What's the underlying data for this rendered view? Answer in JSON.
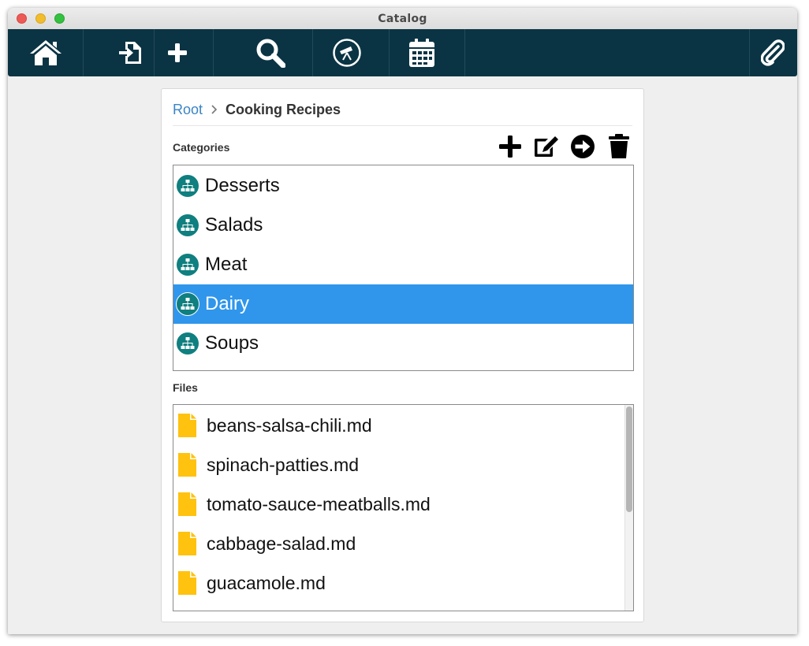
{
  "window": {
    "title": "Catalog"
  },
  "toolbar": {
    "buttons": [
      {
        "name": "home",
        "icon": "home-icon"
      },
      {
        "name": "import",
        "icon": "import-file-icon"
      },
      {
        "name": "add",
        "icon": "plus-icon"
      },
      {
        "name": "search",
        "icon": "search-icon"
      },
      {
        "name": "explore",
        "icon": "telescope-icon"
      },
      {
        "name": "calendar",
        "icon": "calendar-icon"
      },
      {
        "name": "attach",
        "icon": "paperclip-icon"
      }
    ]
  },
  "breadcrumb": {
    "root": "Root",
    "current": "Cooking Recipes"
  },
  "categories": {
    "label": "Categories",
    "actions": [
      "plus-icon",
      "edit-icon",
      "arrow-right-circle-icon",
      "trash-icon"
    ],
    "items": [
      {
        "label": "Desserts",
        "selected": false
      },
      {
        "label": "Salads",
        "selected": false
      },
      {
        "label": "Meat",
        "selected": false
      },
      {
        "label": "Dairy",
        "selected": true
      },
      {
        "label": "Soups",
        "selected": false
      }
    ]
  },
  "files": {
    "label": "Files",
    "items": [
      {
        "label": "beans-salsa-chili.md"
      },
      {
        "label": "spinach-patties.md"
      },
      {
        "label": "tomato-sauce-meatballs.md"
      },
      {
        "label": "cabbage-salad.md"
      },
      {
        "label": "guacamole.md"
      }
    ]
  },
  "colors": {
    "toolbar_bg": "#0a3444",
    "accent_link": "#3a84c6",
    "selection": "#2f96ec",
    "category_icon": "#0f7f7f",
    "file_icon": "#ffc20e"
  }
}
